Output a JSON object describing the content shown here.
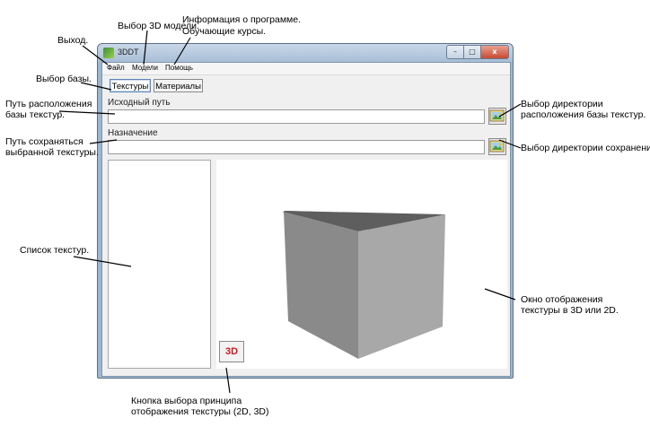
{
  "window": {
    "title": "3DDT",
    "controls": {
      "minimize": "–",
      "maximize": "□",
      "close": "x"
    }
  },
  "menu": {
    "items": [
      "Файл",
      "Модели",
      "Помощь"
    ]
  },
  "base_tabs": {
    "textures": "Текстуры",
    "materials": "Материалы"
  },
  "source_path": {
    "label": "Исходный путь",
    "value": ""
  },
  "destination": {
    "label": "Назначение",
    "value": ""
  },
  "viewer": {
    "mode_button": "3D",
    "mode_button_color": "#cc1a1a",
    "cube_colors": {
      "top": "#5e5e5e",
      "left": "#8a8a8a",
      "right": "#a8a8a8"
    }
  },
  "icons": {
    "app": "app-3d-icon",
    "browse_source": "folder-image-icon",
    "browse_destination": "folder-image-icon"
  },
  "annotations": {
    "exit": "Выход.",
    "model_select": "Выбор 3D модели.",
    "about_line1": "Информация о программе.",
    "about_line2": "Обучающие курсы.",
    "base_select": "Выбор базы.",
    "source_path_line1": "Путь расположения",
    "source_path_line2": "базы текстур.",
    "save_path_line1": "Путь сохраняться",
    "save_path_line2": "выбранной текстуры.",
    "source_dir_line1": "Выбор директории",
    "source_dir_line2": "расположения базы текстур.",
    "save_dir": "Выбор директории сохранения.",
    "texture_list": "Список текстур.",
    "view_line1": "Окно отображения",
    "view_line2": "текстуры в 3D или 2D.",
    "mode_btn_line1": "Кнопка выбора принципа",
    "mode_btn_line2": "отображения текстуры (2D, 3D)"
  }
}
